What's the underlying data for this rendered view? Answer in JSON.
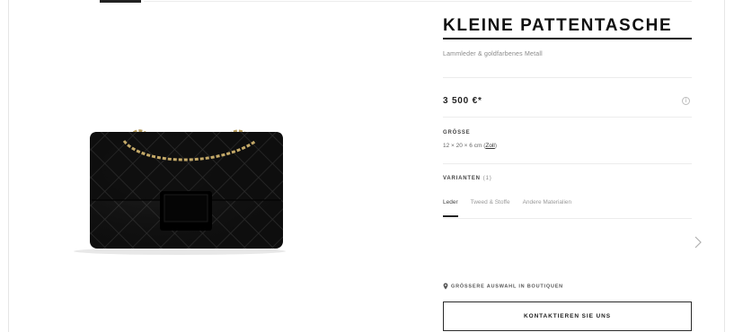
{
  "product": {
    "title": "KLEINE PATTENTASCHE",
    "subtitle": "Lammleder & goldfarbenes Metall",
    "price": "3 500 €*",
    "info_icon": "info-icon",
    "size_label": "GRÖSSE",
    "size_value": "12 × 20 × 6 cm",
    "size_link": "Zoll",
    "variants_label": "VARIANTEN",
    "variants_count": "(1)",
    "tabs": [
      {
        "label": "Leder",
        "active": true
      },
      {
        "label": "Tweed & Stoffe",
        "active": false
      },
      {
        "label": "Andere Materialien",
        "active": false
      }
    ],
    "boutique_text": "GRÖSSERE AUSWAHL IN BOUTIQUEN",
    "contact_label": "KONTAKTIEREN SIE UNS",
    "image": "black-quilted-flap-bag-with-chain-strap"
  }
}
